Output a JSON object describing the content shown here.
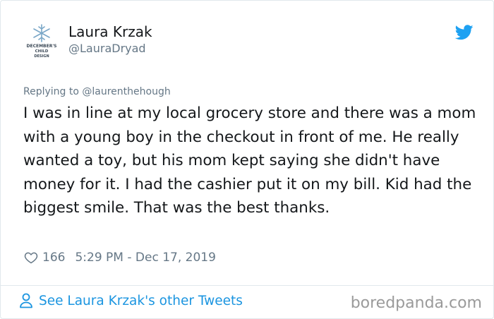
{
  "author": {
    "name": "Laura Krzak",
    "handle": "@LauraDryad",
    "avatar_text": "DECEMBER'S CHILD DESIGN"
  },
  "reply": {
    "label": "Replying to @laurenthehough"
  },
  "tweet": {
    "text": "I was in line at my local grocery store and there was a mom with a young boy in the checkout in front of me. He really wanted a toy, but his mom kept saying she didn't have money for it. I had the cashier put it on my bill. Kid had the biggest smile. That was the best thanks.",
    "likes": "166",
    "timestamp": "5:29 PM - Dec 17, 2019"
  },
  "footer": {
    "link_label": "See Laura Krzak's other Tweets"
  },
  "watermark": "boredpanda.com",
  "icons": {
    "brand": "twitter-bird-icon",
    "like": "heart-icon",
    "profile": "person-icon"
  },
  "colors": {
    "twitter_blue": "#1da1f2",
    "link_blue": "#1b95e0",
    "secondary_text": "#657786",
    "primary_text": "#14171a"
  }
}
